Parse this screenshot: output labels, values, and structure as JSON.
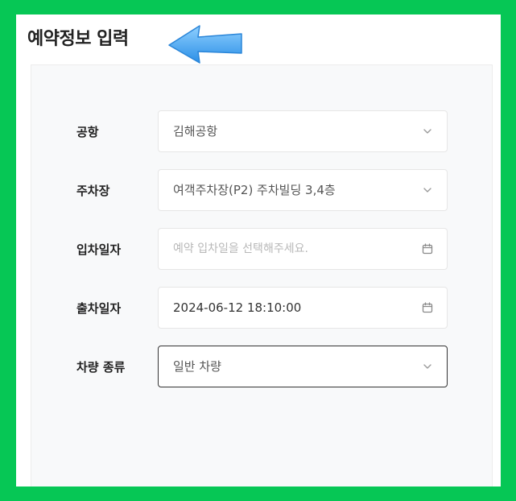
{
  "header": {
    "title": "예약정보 입력"
  },
  "form": {
    "airport": {
      "label": "공항",
      "value": "김해공항"
    },
    "parking": {
      "label": "주차장",
      "value": "여객주차장(P2) 주차빌딩 3,4층"
    },
    "entry_date": {
      "label": "입차일자",
      "value": "",
      "placeholder": "예약 입차일을 선택해주세요."
    },
    "exit_date": {
      "label": "출차일자",
      "value": "2024-06-12 18:10:00"
    },
    "vehicle_type": {
      "label": "차량 종류",
      "value": "일반 차량"
    }
  },
  "colors": {
    "background": "#06c755",
    "arrow": "#3aa0f0",
    "panel": "#f8f9fa"
  },
  "icons": {
    "select": "chevron-down-icon",
    "date": "calendar-icon",
    "annotation": "arrow-left-icon"
  }
}
